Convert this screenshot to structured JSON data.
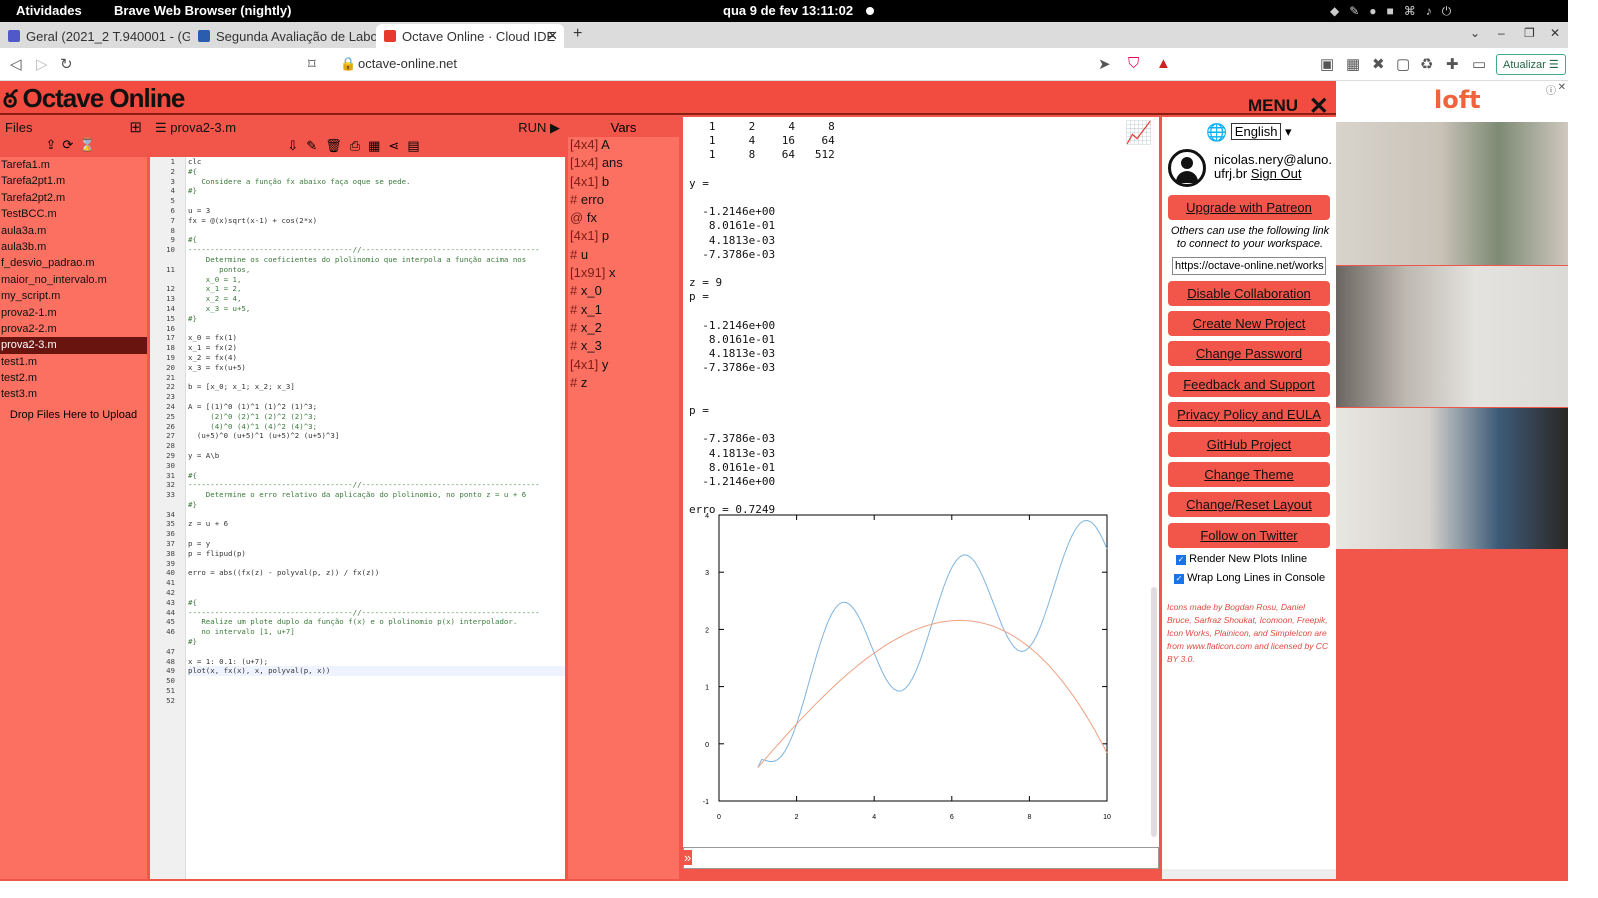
{
  "system_bar": {
    "activities": "Atividades",
    "app": "Brave Web Browser (nightly)",
    "clock": "qua 9 de fev  13:11:02"
  },
  "tabs": [
    {
      "label": "Geral (2021_2 T.940001 - (G"
    },
    {
      "label": "Segunda Avaliação de Labora"
    },
    {
      "label": "Octave Online · Cloud IDE"
    }
  ],
  "address": {
    "url": "octave-online.net",
    "update_btn": "Atualizar"
  },
  "header": {
    "logo": "Octave Online",
    "menu": "MENU"
  },
  "files": {
    "title": "Files",
    "items": [
      "Tarefa1.m",
      "Tarefa2pt1.m",
      "Tarefa2pt2.m",
      "TestBCC.m",
      "aula3a.m",
      "aula3b.m",
      "f_desvio_padrao.m",
      "maior_no_intervalo.m",
      "my_script.m",
      "prova2-1.m",
      "prova2-2.m",
      "prova2-3.m",
      "test1.m",
      "test2.m",
      "test3.m"
    ],
    "selected": "prova2-3.m",
    "drop_hint": "Drop Files Here to Upload"
  },
  "editor": {
    "filename": "prova2-3.m",
    "run": "RUN ▶",
    "lines": [
      "clc",
      "#{",
      "   Considere a função fx abaixo faça oque se pede.",
      "#}",
      "",
      "u = 3",
      "fx = @(x)sqrt(x-1) + cos(2*x)",
      "",
      "#{",
      "-------------------------------------//----------------------------------------",
      "    Determine os coeficientes do plolinomio que interpola a função acima nos",
      "       pontos,",
      "    x_0 = 1,",
      "    x_1 = 2,",
      "    x_2 = 4,",
      "    x_3 = u+5,",
      "#}",
      "",
      "x_0 = fx(1)",
      "x_1 = fx(2)",
      "x_2 = fx(4)",
      "x_3 = fx(u+5)",
      "",
      "b = [x_0; x_1; x_2; x_3]",
      "",
      "A = [(1)^0 (1)^1 (1)^2 (1)^3;",
      "     (2)^0 (2)^1 (2)^2 (2)^3;",
      "     (4)^0 (4)^1 (4)^2 (4)^3;",
      "  (u+5)^0 (u+5)^1 (u+5)^2 (u+5)^3]",
      "",
      "y = A\\b",
      "",
      "#{",
      "-------------------------------------//----------------------------------------",
      "    Determine o erro relativo da aplicação do plolinomio, no ponto z = u + 6",
      "#}",
      "",
      "z = u + 6",
      "",
      "p = y",
      "p = flipud(p)",
      "",
      "erro = abs((fx(z) - polyval(p, z)) / fx(z))",
      "",
      "",
      "#{",
      "-------------------------------------//----------------------------------------",
      "   Realize um plote duplo da função f(x) e o plolinomio p(x) interpolador.",
      "   no intervalo [1, u+7]",
      "#}",
      "",
      "x = 1: 0.1: (u+7);",
      "plot(x, fx(x), x, polyval(p, x))"
    ],
    "line_numbers": [
      "1",
      "2",
      "3",
      "4",
      "5",
      "6",
      "7",
      "8",
      "9",
      "10",
      "",
      "11",
      "",
      "12",
      "13",
      "14",
      "15",
      "16",
      "17",
      "18",
      "19",
      "20",
      "21",
      "22",
      "23",
      "24",
      "25",
      "26",
      "27",
      "28",
      "29",
      "30",
      "31",
      "32",
      "33",
      "",
      "34",
      "35",
      "36",
      "37",
      "38",
      "39",
      "40",
      "41",
      "42",
      "43",
      "44",
      "45",
      "46",
      "",
      "47",
      "48",
      "49",
      "50",
      "51",
      "52"
    ]
  },
  "vars": {
    "title": "Vars",
    "items": [
      {
        "type": "[4x4]",
        "name": "A"
      },
      {
        "type": "[1x4]",
        "name": "ans"
      },
      {
        "type": "[4x1]",
        "name": "b"
      },
      {
        "type": "#",
        "name": "erro"
      },
      {
        "type": "@",
        "name": "fx"
      },
      {
        "type": "[4x1]",
        "name": "p"
      },
      {
        "type": "#",
        "name": "u"
      },
      {
        "type": "[1x91]",
        "name": "x"
      },
      {
        "type": "#",
        "name": "x_0"
      },
      {
        "type": "#",
        "name": "x_1"
      },
      {
        "type": "#",
        "name": "x_2"
      },
      {
        "type": "#",
        "name": "x_3"
      },
      {
        "type": "[4x1]",
        "name": "y"
      },
      {
        "type": "#",
        "name": "z"
      }
    ]
  },
  "console": {
    "text": "   1     2     4     8\n   1     4    16    64\n   1     8    64   512\n\ny =\n\n  -1.2146e+00\n   8.0161e-01\n   4.1813e-03\n  -7.3786e-03\n\nz = 9\np =\n\n  -1.2146e+00\n   8.0161e-01\n   4.1813e-03\n  -7.3786e-03\n\n\np =\n\n  -7.3786e-03\n   4.1813e-03\n   8.0161e-01\n  -1.2146e+00\n\nerro = 0.7249"
  },
  "chart_data": {
    "type": "line",
    "xlim": [
      0,
      10
    ],
    "ylim": [
      -1,
      4
    ],
    "xticks": [
      "0",
      "2",
      "4",
      "6",
      "8",
      "10"
    ],
    "yticks": [
      "-1",
      "0",
      "1",
      "2",
      "3",
      "4"
    ],
    "series": [
      {
        "color": "#7fb4e0",
        "expr": "sqrt(x-1)+cos(2x)"
      },
      {
        "color": "#f0a080",
        "expr": "-0.0073786x^3+0.0041813x^2+0.80161x-1.2146"
      }
    ],
    "x_range": [
      1,
      10
    ]
  },
  "account": {
    "language": "English",
    "email": "nicolas.nery@aluno.ufrj.br",
    "sign_out": "Sign Out",
    "upgrade": "Upgrade with Patreon",
    "share_note": "Others can use the following link to connect to your workspace.",
    "share_url": "https://octave-online.net/works",
    "buttons": [
      "Disable Collaboration",
      "Create New Project",
      "Change Password",
      "Feedback and Support",
      "Privacy Policy and EULA",
      "GitHub Project",
      "Change Theme",
      "Change/Reset Layout",
      "Follow on Twitter"
    ],
    "check1": "Render New Plots Inline",
    "check2": "Wrap Long Lines in Console",
    "credits": "Icons made by Bogdan Rosu, Daniel Bruce, Sarfraz Shoukat, Icomoon, Freepik, Icon Works, Plainicon, and SimpleIcon are from www.flaticon.com and licensed by CC BY 3.0."
  },
  "ad": {
    "brand": "loft"
  },
  "colors": {
    "accent": "#f2554a",
    "panel": "#fc7062",
    "selected": "#6a1410"
  }
}
